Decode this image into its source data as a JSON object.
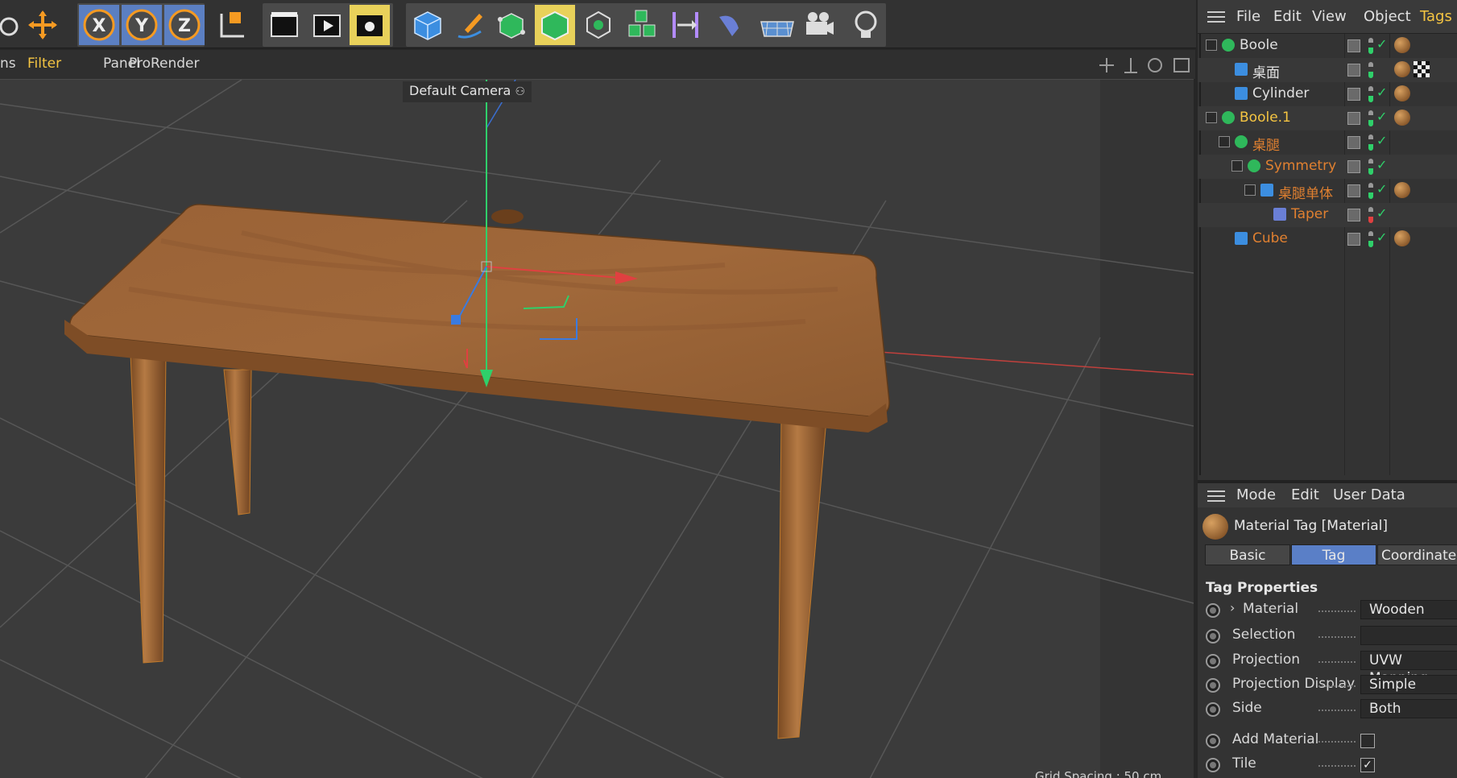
{
  "viewport_menu": {
    "items": [
      "ns",
      "Filter",
      "Panel",
      "ProRender"
    ],
    "camera_label": "Default Camera",
    "grid_spacing": "Grid Spacing : 50 cm"
  },
  "toolbar": {
    "axis_buttons": [
      "X",
      "Y",
      "Z"
    ],
    "tools": [
      "rotate-icon",
      "move-icon",
      "x-axis-lock",
      "y-axis-lock",
      "z-axis-lock",
      "coordinate-system-icon",
      "render-view-icon",
      "render-picture-viewer-icon",
      "render-settings-icon",
      "cube-object-icon",
      "pen-spline-icon",
      "subdivision-icon",
      "extrude-icon",
      "cloner-icon",
      "mograph-icon",
      "symmetry-deformer-icon",
      "bend-deformer-icon",
      "floor-icon",
      "camera-icon",
      "light-icon"
    ]
  },
  "object_manager": {
    "menu": [
      "File",
      "Edit",
      "View",
      "Object",
      "Tags"
    ],
    "objects": [
      {
        "name": "Boole",
        "color": "#e0e0e0",
        "indent": 0,
        "icon": "boole-icon"
      },
      {
        "name": "桌面",
        "color": "#e0e0e0",
        "indent": 1,
        "icon": "polygon-icon"
      },
      {
        "name": "Cylinder",
        "color": "#e0e0e0",
        "indent": 1,
        "icon": "cylinder-icon"
      },
      {
        "name": "Boole.1",
        "color": "#f5c542",
        "indent": 0,
        "icon": "boole-icon"
      },
      {
        "name": "桌腿",
        "color": "#e08030",
        "indent": 1,
        "icon": "symmetry-icon"
      },
      {
        "name": "Symmetry",
        "color": "#e08030",
        "indent": 2,
        "icon": "symmetry-icon"
      },
      {
        "name": "桌腿单体",
        "color": "#e08030",
        "indent": 3,
        "icon": "cylinder-icon"
      },
      {
        "name": "Taper",
        "color": "#e08030",
        "indent": 4,
        "icon": "taper-icon"
      },
      {
        "name": "Cube",
        "color": "#e08030",
        "indent": 1,
        "icon": "cube-icon"
      }
    ]
  },
  "attribute_manager": {
    "menu": [
      "Mode",
      "Edit",
      "User Data"
    ],
    "title": "Material Tag [Material]",
    "tabs": [
      "Basic",
      "Tag",
      "Coordinates"
    ],
    "active_tab": "Tag",
    "section": "Tag Properties",
    "properties": [
      {
        "label": "Material",
        "value": "Wooden",
        "expandable": true
      },
      {
        "label": "Selection",
        "value": ""
      },
      {
        "label": "Projection",
        "value": "UVW Mapping"
      },
      {
        "label": "Projection Display",
        "value": "Simple"
      },
      {
        "label": "Side",
        "value": "Both"
      },
      {
        "label": "Add Material",
        "checkbox": false
      },
      {
        "label": "Tile",
        "checkbox": true
      }
    ]
  },
  "colors": {
    "accent": "#f5c542",
    "orange": "#e08030",
    "active_tab": "#5a7fc7"
  }
}
